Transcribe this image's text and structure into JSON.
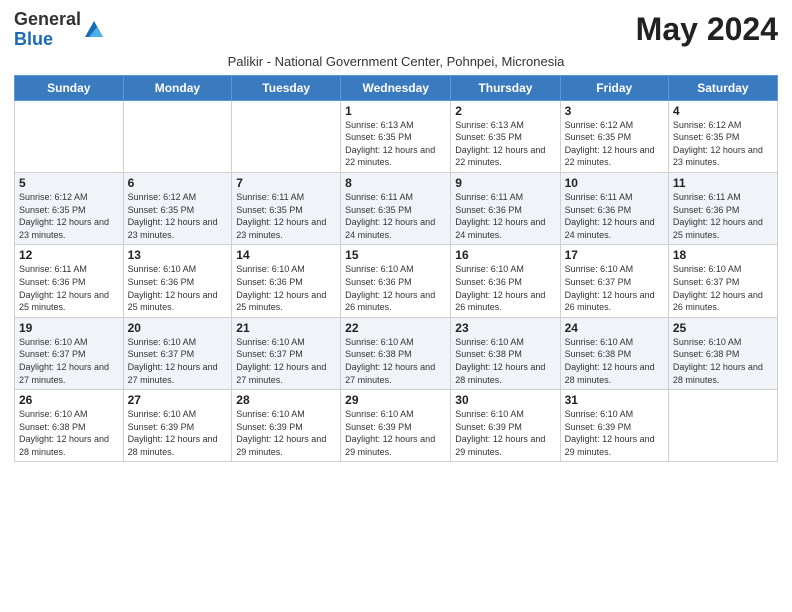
{
  "header": {
    "logo_general": "General",
    "logo_blue": "Blue",
    "title": "May 2024",
    "subtitle": "Palikir - National Government Center, Pohnpei, Micronesia"
  },
  "weekdays": [
    "Sunday",
    "Monday",
    "Tuesday",
    "Wednesday",
    "Thursday",
    "Friday",
    "Saturday"
  ],
  "weeks": [
    [
      {
        "day": "",
        "sunrise": "",
        "sunset": "",
        "daylight": ""
      },
      {
        "day": "",
        "sunrise": "",
        "sunset": "",
        "daylight": ""
      },
      {
        "day": "",
        "sunrise": "",
        "sunset": "",
        "daylight": ""
      },
      {
        "day": "1",
        "sunrise": "6:13 AM",
        "sunset": "6:35 PM",
        "daylight": "12 hours and 22 minutes."
      },
      {
        "day": "2",
        "sunrise": "6:13 AM",
        "sunset": "6:35 PM",
        "daylight": "12 hours and 22 minutes."
      },
      {
        "day": "3",
        "sunrise": "6:12 AM",
        "sunset": "6:35 PM",
        "daylight": "12 hours and 22 minutes."
      },
      {
        "day": "4",
        "sunrise": "6:12 AM",
        "sunset": "6:35 PM",
        "daylight": "12 hours and 23 minutes."
      }
    ],
    [
      {
        "day": "5",
        "sunrise": "6:12 AM",
        "sunset": "6:35 PM",
        "daylight": "12 hours and 23 minutes."
      },
      {
        "day": "6",
        "sunrise": "6:12 AM",
        "sunset": "6:35 PM",
        "daylight": "12 hours and 23 minutes."
      },
      {
        "day": "7",
        "sunrise": "6:11 AM",
        "sunset": "6:35 PM",
        "daylight": "12 hours and 23 minutes."
      },
      {
        "day": "8",
        "sunrise": "6:11 AM",
        "sunset": "6:35 PM",
        "daylight": "12 hours and 24 minutes."
      },
      {
        "day": "9",
        "sunrise": "6:11 AM",
        "sunset": "6:36 PM",
        "daylight": "12 hours and 24 minutes."
      },
      {
        "day": "10",
        "sunrise": "6:11 AM",
        "sunset": "6:36 PM",
        "daylight": "12 hours and 24 minutes."
      },
      {
        "day": "11",
        "sunrise": "6:11 AM",
        "sunset": "6:36 PM",
        "daylight": "12 hours and 25 minutes."
      }
    ],
    [
      {
        "day": "12",
        "sunrise": "6:11 AM",
        "sunset": "6:36 PM",
        "daylight": "12 hours and 25 minutes."
      },
      {
        "day": "13",
        "sunrise": "6:10 AM",
        "sunset": "6:36 PM",
        "daylight": "12 hours and 25 minutes."
      },
      {
        "day": "14",
        "sunrise": "6:10 AM",
        "sunset": "6:36 PM",
        "daylight": "12 hours and 25 minutes."
      },
      {
        "day": "15",
        "sunrise": "6:10 AM",
        "sunset": "6:36 PM",
        "daylight": "12 hours and 26 minutes."
      },
      {
        "day": "16",
        "sunrise": "6:10 AM",
        "sunset": "6:36 PM",
        "daylight": "12 hours and 26 minutes."
      },
      {
        "day": "17",
        "sunrise": "6:10 AM",
        "sunset": "6:37 PM",
        "daylight": "12 hours and 26 minutes."
      },
      {
        "day": "18",
        "sunrise": "6:10 AM",
        "sunset": "6:37 PM",
        "daylight": "12 hours and 26 minutes."
      }
    ],
    [
      {
        "day": "19",
        "sunrise": "6:10 AM",
        "sunset": "6:37 PM",
        "daylight": "12 hours and 27 minutes."
      },
      {
        "day": "20",
        "sunrise": "6:10 AM",
        "sunset": "6:37 PM",
        "daylight": "12 hours and 27 minutes."
      },
      {
        "day": "21",
        "sunrise": "6:10 AM",
        "sunset": "6:37 PM",
        "daylight": "12 hours and 27 minutes."
      },
      {
        "day": "22",
        "sunrise": "6:10 AM",
        "sunset": "6:38 PM",
        "daylight": "12 hours and 27 minutes."
      },
      {
        "day": "23",
        "sunrise": "6:10 AM",
        "sunset": "6:38 PM",
        "daylight": "12 hours and 28 minutes."
      },
      {
        "day": "24",
        "sunrise": "6:10 AM",
        "sunset": "6:38 PM",
        "daylight": "12 hours and 28 minutes."
      },
      {
        "day": "25",
        "sunrise": "6:10 AM",
        "sunset": "6:38 PM",
        "daylight": "12 hours and 28 minutes."
      }
    ],
    [
      {
        "day": "26",
        "sunrise": "6:10 AM",
        "sunset": "6:38 PM",
        "daylight": "12 hours and 28 minutes."
      },
      {
        "day": "27",
        "sunrise": "6:10 AM",
        "sunset": "6:39 PM",
        "daylight": "12 hours and 28 minutes."
      },
      {
        "day": "28",
        "sunrise": "6:10 AM",
        "sunset": "6:39 PM",
        "daylight": "12 hours and 29 minutes."
      },
      {
        "day": "29",
        "sunrise": "6:10 AM",
        "sunset": "6:39 PM",
        "daylight": "12 hours and 29 minutes."
      },
      {
        "day": "30",
        "sunrise": "6:10 AM",
        "sunset": "6:39 PM",
        "daylight": "12 hours and 29 minutes."
      },
      {
        "day": "31",
        "sunrise": "6:10 AM",
        "sunset": "6:39 PM",
        "daylight": "12 hours and 29 minutes."
      },
      {
        "day": "",
        "sunrise": "",
        "sunset": "",
        "daylight": ""
      }
    ]
  ],
  "labels": {
    "sunrise_prefix": "Sunrise: ",
    "sunset_prefix": "Sunset: ",
    "daylight_prefix": "Daylight: "
  }
}
